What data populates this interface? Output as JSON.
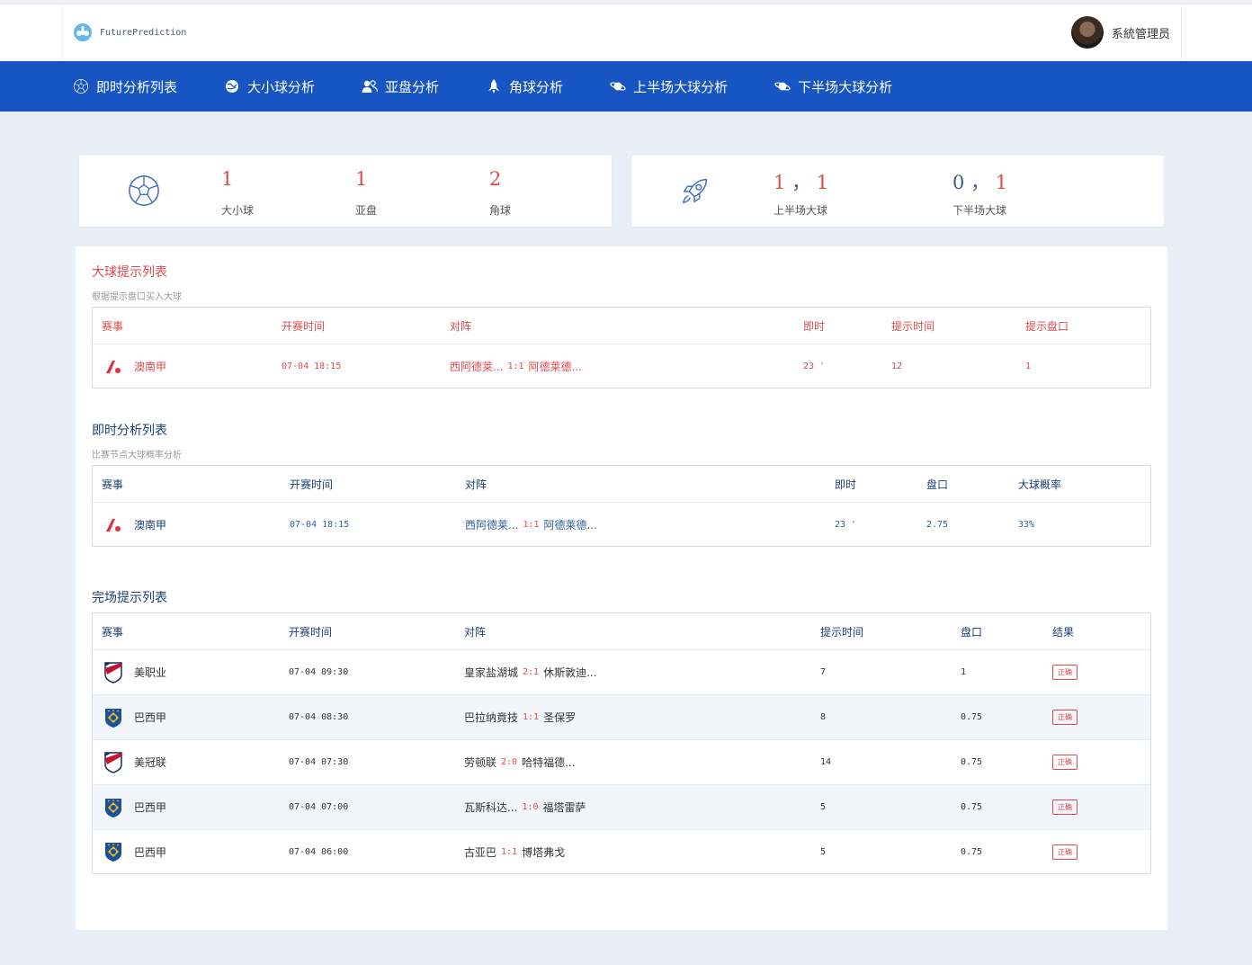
{
  "app": {
    "brand": "FuturePrediction",
    "user_name": "系統管理员"
  },
  "nav": {
    "items": [
      {
        "label": "即时分析列表",
        "icon": "soccer-ball-icon"
      },
      {
        "label": "大小球分析",
        "icon": "globe-icon"
      },
      {
        "label": "亚盘分析",
        "icon": "users-icon"
      },
      {
        "label": "角球分析",
        "icon": "rocket-icon"
      },
      {
        "label": "上半场大球分析",
        "icon": "planet-icon"
      },
      {
        "label": "下半场大球分析",
        "icon": "planet-icon"
      }
    ]
  },
  "stats": {
    "left": {
      "icon": "soccer-ball-icon",
      "items": [
        {
          "value": "1",
          "label": "大小球"
        },
        {
          "value": "1",
          "label": "亚盘"
        },
        {
          "value": "2",
          "label": "角球"
        }
      ]
    },
    "right": {
      "icon": "rocket-icon",
      "first_half": {
        "a": "1",
        "sep": "，",
        "b": "1",
        "label": "上半场大球"
      },
      "second_half": {
        "a": "0",
        "sep": "，",
        "b": "1",
        "label": "下半场大球"
      }
    }
  },
  "big_ball": {
    "title": "大球提示列表",
    "subtitle": "根据提示盘口买入大球",
    "headers": [
      "赛事",
      "开赛时间",
      "对阵",
      "即时",
      "提示时间",
      "提示盘口"
    ],
    "rows": [
      {
        "league": "澳南甲",
        "league_icon": "a-league-logo-icon",
        "time": "07-04 18:15",
        "home": "西阿德莱...",
        "score": "1:1",
        "away": "阿德莱德...",
        "live": "23 '",
        "tip_time": "12",
        "tip_line": "1"
      }
    ]
  },
  "live_analysis": {
    "title": "即时分析列表",
    "subtitle": "比赛节点大球概率分析",
    "headers": [
      "赛事",
      "开赛时间",
      "对阵",
      "即时",
      "盘口",
      "大球概率"
    ],
    "rows": [
      {
        "league": "澳南甲",
        "league_icon": "a-league-logo-icon",
        "time": "07-04 18:15",
        "home": "西阿德莱...",
        "score": "1:1",
        "away": "阿德莱德...",
        "live": "23 '",
        "line": "2.75",
        "prob": "33%"
      }
    ]
  },
  "full_time": {
    "title": "完场提示列表",
    "headers": [
      "赛事",
      "开赛时间",
      "对阵",
      "提示时间",
      "盘口",
      "结果"
    ],
    "rows": [
      {
        "league": "美职业",
        "league_icon": "mls-logo-icon",
        "time": "07-04 09:30",
        "home": "皇家盐湖城",
        "score": "2:1",
        "away": "休斯敦迪...",
        "tip_time": "7",
        "line": "1",
        "result": "正确"
      },
      {
        "league": "巴西甲",
        "league_icon": "brazil-cbf-logo-icon",
        "time": "07-04 08:30",
        "home": "巴拉纳竟技",
        "score": "1:1",
        "away": "圣保罗",
        "tip_time": "8",
        "line": "0.75",
        "result": "正确"
      },
      {
        "league": "美冠联",
        "league_icon": "mls-logo-icon",
        "time": "07-04 07:30",
        "home": "劳顿联",
        "score": "2:0",
        "away": "哈特福德...",
        "tip_time": "14",
        "line": "0.75",
        "result": "正确"
      },
      {
        "league": "巴西甲",
        "league_icon": "brazil-cbf-logo-icon",
        "time": "07-04 07:00",
        "home": "瓦斯科达...",
        "score": "1:0",
        "away": "福塔雷萨",
        "tip_time": "5",
        "line": "0.75",
        "result": "正确"
      },
      {
        "league": "巴西甲",
        "league_icon": "brazil-cbf-logo-icon",
        "time": "07-04 06:00",
        "home": "古亚巴",
        "score": "1:1",
        "away": "博塔弗戈",
        "tip_time": "5",
        "line": "0.75",
        "result": "正确"
      }
    ]
  },
  "colors": {
    "nav_bg": "#1755c2",
    "accent_red": "#e04a4a",
    "navy_text": "#1d3f78",
    "page_bg": "#e8eef6"
  }
}
